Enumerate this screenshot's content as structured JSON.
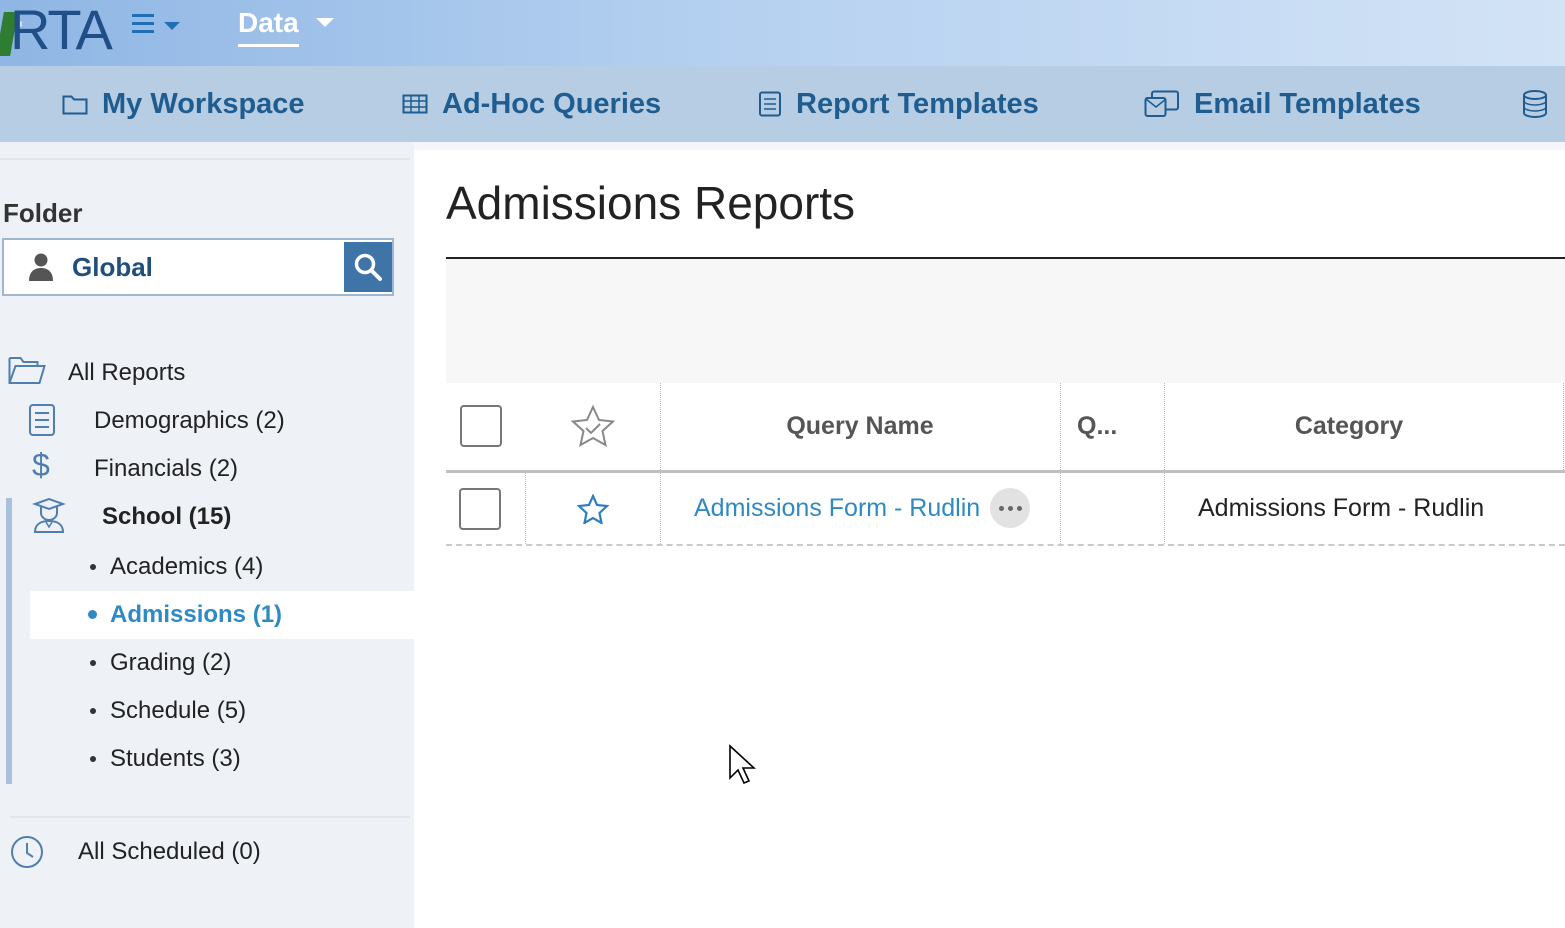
{
  "app": {
    "logo_text": "RTA",
    "data_menu_label": "Data"
  },
  "nav": {
    "items": [
      {
        "label": "My Workspace",
        "icon": "folder-icon"
      },
      {
        "label": "Ad-Hoc Queries",
        "icon": "grid-icon"
      },
      {
        "label": "Report Templates",
        "icon": "document-icon"
      },
      {
        "label": "Email Templates",
        "icon": "email-icon"
      },
      {
        "label": "",
        "icon": "database-icon"
      }
    ]
  },
  "sidebar": {
    "folder_label": "Folder",
    "folder_value": "Global",
    "tree": {
      "all_reports": "All Reports",
      "demographics": "Demographics (2)",
      "financials": "Financials (2)",
      "school": "School (15)",
      "school_children": [
        {
          "label": "Academics (4)",
          "selected": false
        },
        {
          "label": "Admissions (1)",
          "selected": true
        },
        {
          "label": "Grading (2)",
          "selected": false
        },
        {
          "label": "Schedule (5)",
          "selected": false
        },
        {
          "label": "Students (3)",
          "selected": false
        }
      ],
      "all_scheduled": "All Scheduled (0)"
    }
  },
  "main": {
    "title": "Admissions Reports",
    "table": {
      "columns": [
        "Query Name",
        "Q...",
        "Category"
      ],
      "rows": [
        {
          "query_name": "Admissions Form - Rudlin",
          "q": "",
          "category": "Admissions Form - Rudlin"
        }
      ]
    }
  },
  "colors": {
    "accent": "#2f8ac4",
    "nav_bg": "#b7cde4",
    "nav_text": "#1f5c8f",
    "search_button": "#3f74a8"
  }
}
